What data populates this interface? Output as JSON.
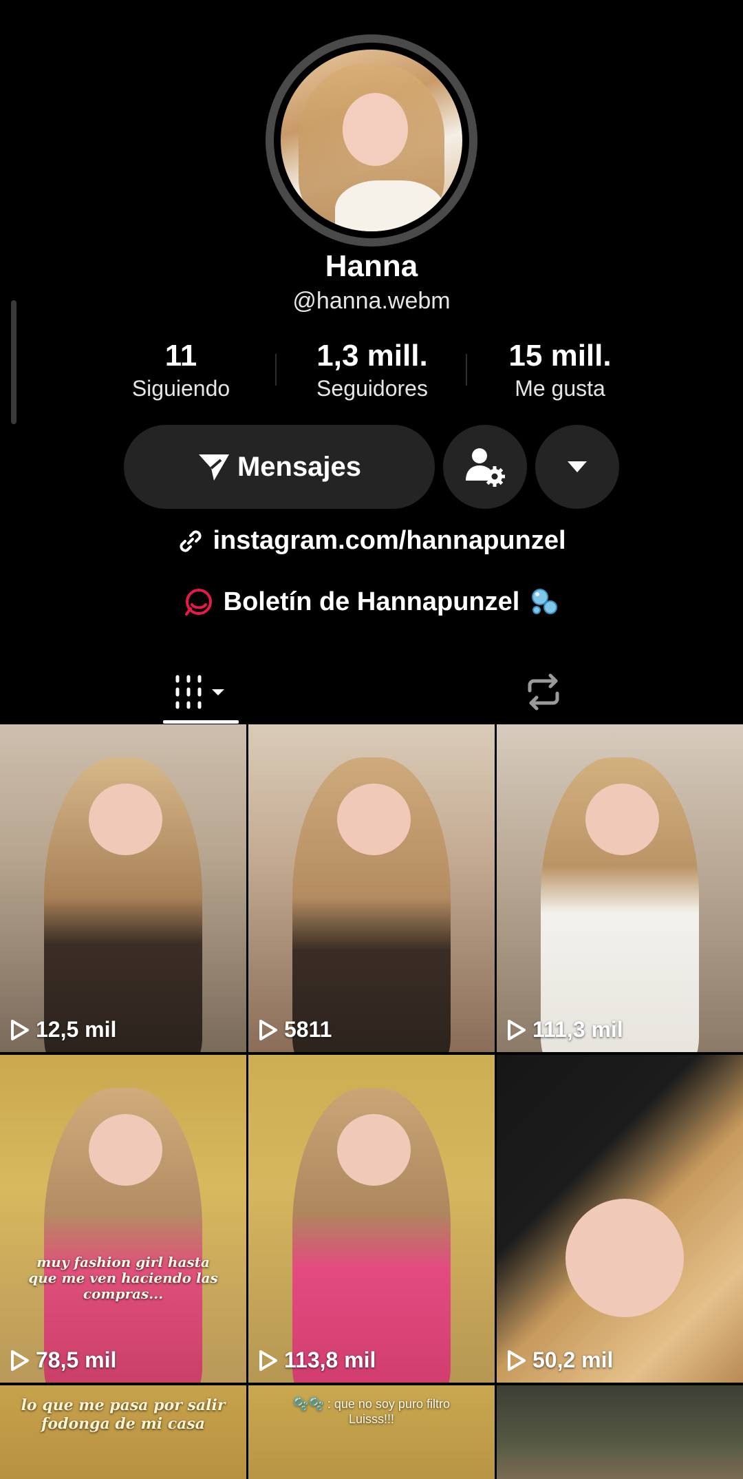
{
  "profile": {
    "name": "Hanna",
    "handle": "@hanna.webm"
  },
  "stats": [
    {
      "value": "11",
      "label": "Siguiendo"
    },
    {
      "value": "1,3 mill.",
      "label": "Seguidores"
    },
    {
      "value": "15 mill.",
      "label": "Me gusta"
    }
  ],
  "actions": {
    "messages_label": "Mensajes"
  },
  "bio": {
    "link": "instagram.com/hannapunzel",
    "newsletter": "Boletín de Hannapunzel"
  },
  "colors": {
    "newsletter_icon": "#e8194a",
    "background": "#000000",
    "button_bg": "#242424"
  },
  "videos": [
    {
      "views": "12,5 mil",
      "caption": ""
    },
    {
      "views": "5811",
      "caption": ""
    },
    {
      "views": "111,3 mil",
      "caption": ""
    },
    {
      "views": "78,5 mil",
      "caption": "muy fashion girl hasta que me ven haciendo las compras..."
    },
    {
      "views": "113,8 mil",
      "caption": ""
    },
    {
      "views": "50,2 mil",
      "caption": ""
    },
    {
      "views": "",
      "caption": "lo que me pasa por salir fodonga de mi casa"
    },
    {
      "views": "",
      "caption": "🫧🫧 : que no soy puro filtro Luisss!!!"
    },
    {
      "views": "",
      "caption": ""
    }
  ]
}
